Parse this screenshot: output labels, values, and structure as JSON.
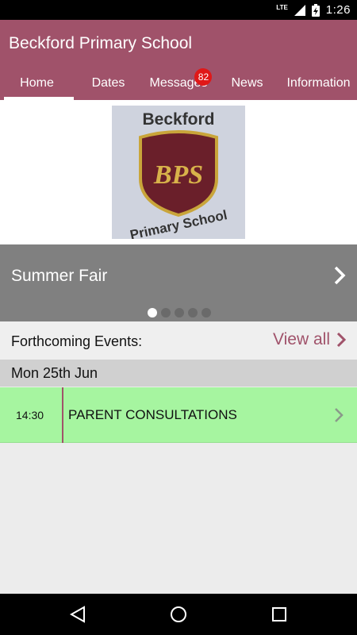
{
  "status_bar": {
    "network": "LTE",
    "time": "1:26"
  },
  "app": {
    "title": "Beckford Primary School"
  },
  "tabs": [
    {
      "label": "Home"
    },
    {
      "label": "Dates"
    },
    {
      "label": "Messages",
      "badge": "82"
    },
    {
      "label": "News"
    },
    {
      "label": "Information"
    }
  ],
  "logo": {
    "text_top": "Beckford",
    "monogram": "BPS",
    "text_bottom": "Primary School"
  },
  "banner": {
    "title": "Summer Fair",
    "slide_count": 5,
    "active_slide": 1
  },
  "forthcoming": {
    "label": "Forthcoming Events:",
    "view_all": "View all"
  },
  "events": {
    "date": "Mon 25th Jun",
    "items": [
      {
        "time": "14:30",
        "title": "PARENT CONSULTATIONS"
      }
    ]
  },
  "colors": {
    "accent": "#a0526a",
    "event_bg": "#a6f5a0",
    "banner_bg": "#808080"
  }
}
